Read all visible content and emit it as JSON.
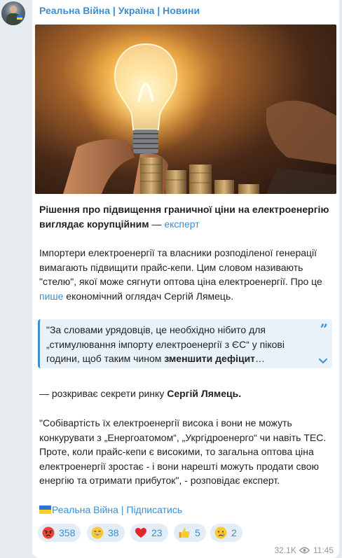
{
  "channel": {
    "name": "Реальна Війна | Україна | Новини",
    "avatar_icon": "soldier-avatar"
  },
  "post": {
    "headline_bold": "Рішення про підвищення граничної ціни на електроенергію виглядає корупційним",
    "headline_dash": " — ",
    "headline_link": "експерт",
    "p1_a": "Імпортери електроенергії та власники розподіленої генерації вимагають підвищити прайс-кепи. Цим словом називають \"стелю\", якої може сягнути оптова ціна електроенергії. Про це ",
    "p1_link": "пише",
    "p1_b": " економічний оглядач Сергій Лямець.",
    "quote_a": "\"За словами урядовців, це необхідно нібито для „стимулювання імпорту електроенергії з ЄС“ у пікові години, щоб таким чином ",
    "quote_bold": "зменшити дефіцит",
    "quote_ellipsis": "…",
    "quote_mark": "”",
    "p2_a": "— розкриває секрети ринку ",
    "p2_bold": "Сергій Лямець.",
    "p3": "\"Собівартість їх електроенергії висока і вони не можуть конкурувати з „Енергоатомом“, „Укргідроенерго“ чи навіть ТЕС. Проте, коли прайс-кепи є високими, то загальна оптова ціна електроенергії зростає - і вони нарешті можуть продати свою енергію та отримати прибуток\", - розповідає експерт."
  },
  "footer": {
    "channel_link": "Реальна Війна",
    "separator": " | ",
    "subscribe_link": "Підписатись"
  },
  "reactions": [
    {
      "icon": "angry-face-icon",
      "count": "358"
    },
    {
      "icon": "grinning-face-icon",
      "count": "38"
    },
    {
      "icon": "red-heart-icon",
      "count": "23"
    },
    {
      "icon": "thumbs-up-icon",
      "count": "5"
    },
    {
      "icon": "crying-face-icon",
      "count": "2"
    }
  ],
  "meta": {
    "views": "32.1K",
    "time": "11:45"
  },
  "colors": {
    "accent": "#3a8ed3",
    "background": "#e5ebef",
    "bubble": "#ffffff",
    "quote_bg": "#e9f1f9",
    "reaction_bg": "#e4edf6",
    "flag_blue": "#2f6fd6",
    "flag_yellow": "#f7d21d"
  }
}
